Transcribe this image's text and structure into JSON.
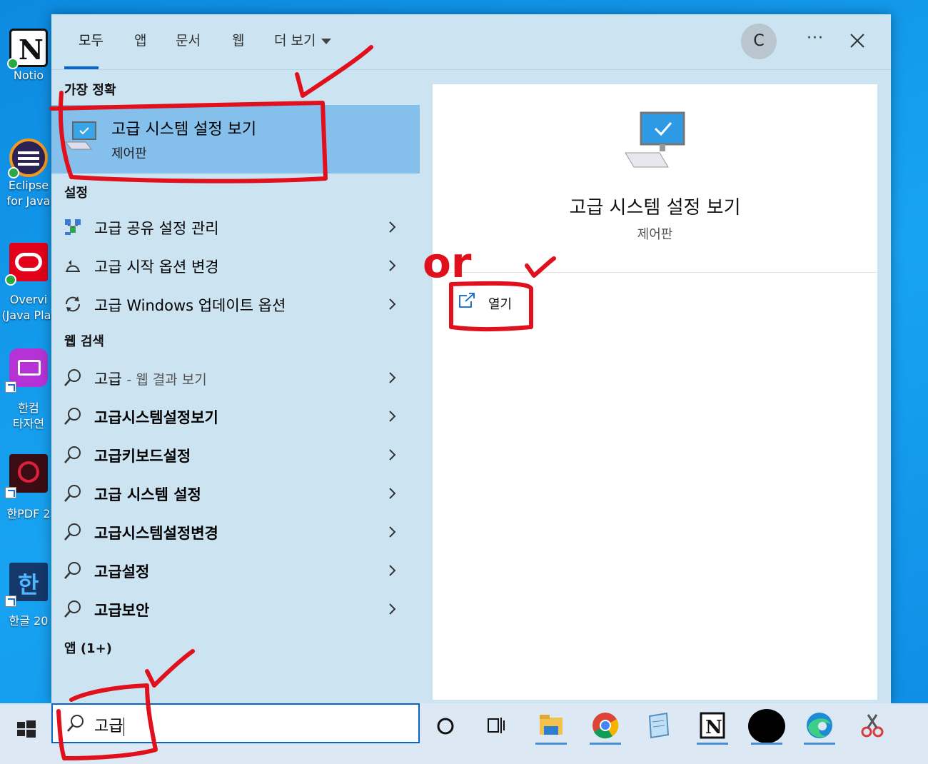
{
  "desktop_icons": [
    {
      "name": "Notion",
      "label1": "Notio",
      "label2": ""
    },
    {
      "name": "Eclipse",
      "label1": "Eclipse",
      "label2": "for Java"
    },
    {
      "name": "Oracle",
      "label1": "Overvi",
      "label2": "(Java Plat"
    },
    {
      "name": "Hancom Typing",
      "label1": "한컴",
      "label2": "타자연"
    },
    {
      "name": "HanPDF",
      "label1": "한PDF 2",
      "label2": ""
    },
    {
      "name": "Hangul",
      "label1": "한글 20",
      "label2": ""
    }
  ],
  "tabs": [
    {
      "label": "모두",
      "active": true
    },
    {
      "label": "앱"
    },
    {
      "label": "문서"
    },
    {
      "label": "웹"
    },
    {
      "label": "더 보기"
    }
  ],
  "account_initial": "C",
  "more_label": "···",
  "sections": {
    "best_match": "가장 정확",
    "settings": "설정",
    "web_search": "웹 검색",
    "apps": "앱 (1+)"
  },
  "best_match": {
    "title": "고급 시스템 설정 보기",
    "subtitle": "제어판"
  },
  "settings_items": [
    {
      "label": "고급 공유 설정 관리",
      "icon": "network-share-icon"
    },
    {
      "label": "고급 시작 옵션 변경",
      "icon": "recovery-icon"
    },
    {
      "label": "고급 Windows 업데이트 옵션",
      "icon": "sync-icon"
    }
  ],
  "web_items": [
    {
      "label": "고급",
      "suffix": "- 웹 결과 보기"
    },
    {
      "label": "고급시스템설정보기",
      "suffix": ""
    },
    {
      "label": "고급키보드설정",
      "suffix": ""
    },
    {
      "label": "고급 시스템 설정",
      "suffix": ""
    },
    {
      "label": "고급시스템설정변경",
      "suffix": ""
    },
    {
      "label": "고급설정",
      "suffix": ""
    },
    {
      "label": "고급보안",
      "suffix": ""
    }
  ],
  "detail": {
    "title": "고급 시스템 설정 보기",
    "subtitle": "제어판",
    "open_label": "열기"
  },
  "search": {
    "query": "고급"
  },
  "annotations": {
    "or_text": "or"
  },
  "colors": {
    "accent": "#0a64c8",
    "selection": "#84c0eb",
    "annotation_red": "#e0101c"
  }
}
